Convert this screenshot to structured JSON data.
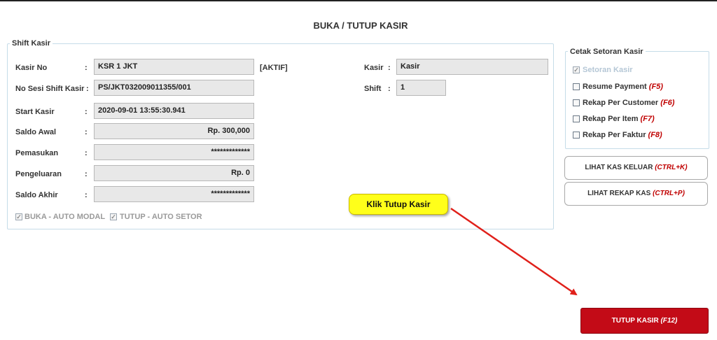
{
  "page": {
    "title": "BUKA / TUTUP KASIR"
  },
  "shift": {
    "legend": "Shift Kasir",
    "fields": {
      "kasir_no": {
        "label": "Kasir No",
        "value": "KSR 1 JKT",
        "status": "[AKTIF]"
      },
      "no_sesi": {
        "label": "No Sesi Shift Kasir",
        "value": "PS/JKT032009011355/001"
      },
      "start_kasir": {
        "label": "Start Kasir",
        "value": "2020-09-01 13:55:30.941"
      },
      "saldo_awal": {
        "label": "Saldo Awal",
        "value": "Rp. 300,000"
      },
      "pemasukan": {
        "label": "Pemasukan",
        "value": "*************"
      },
      "pengeluaran": {
        "label": "Pengeluaran",
        "value": "Rp. 0"
      },
      "saldo_akhir": {
        "label": "Saldo Akhir",
        "value": "*************"
      },
      "kasir": {
        "label": "Kasir",
        "value": "Kasir"
      },
      "shift": {
        "label": "Shift",
        "value": "1"
      }
    },
    "colon": ":",
    "options": {
      "buka_auto_modal": {
        "label": "BUKA - AUTO MODAL",
        "checked": true
      },
      "tutup_auto_setor": {
        "label": "TUTUP - AUTO SETOR",
        "checked": true
      }
    }
  },
  "cetak": {
    "legend": "Cetak Setoran Kasir",
    "items": [
      {
        "label": "Setoran Kasir",
        "key": "",
        "checked": true,
        "disabled": true
      },
      {
        "label": "Resume Payment",
        "key": "(F5)",
        "checked": false
      },
      {
        "label": "Rekap Per Customer",
        "key": "(F6)",
        "checked": false
      },
      {
        "label": "Rekap Per Item",
        "key": "(F7)",
        "checked": false
      },
      {
        "label": "Rekap Per Faktur",
        "key": "(F8)",
        "checked": false
      }
    ]
  },
  "buttons": {
    "lihat_kas_keluar": {
      "label": "LIHAT KAS KELUAR",
      "key": "(CTRL+K)"
    },
    "lihat_rekap_kas": {
      "label": "LIHAT REKAP KAS",
      "key": "(CTRL+P)"
    },
    "tutup_kasir": {
      "label": "TUTUP KASIR",
      "key": "(F12)"
    }
  },
  "annotation": {
    "callout": "Klik Tutup Kasir"
  },
  "colors": {
    "accent_red": "#c30b17",
    "callout_yellow": "#ffff1a",
    "arrow_red": "#e0201a"
  },
  "icons": {
    "checkbox_checked": "check-icon"
  }
}
